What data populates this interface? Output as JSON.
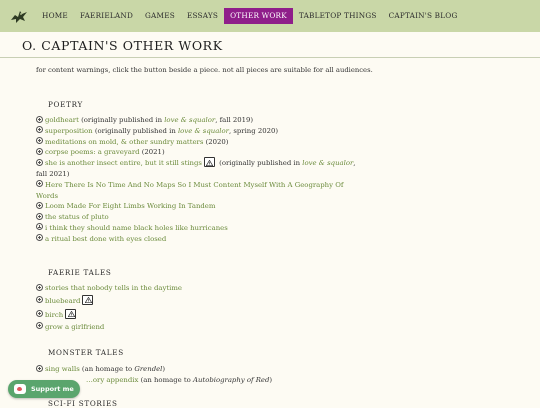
{
  "nav": {
    "items": [
      {
        "label": "Home"
      },
      {
        "label": "Faerieland"
      },
      {
        "label": "Games"
      },
      {
        "label": "Essays"
      },
      {
        "label": "Other Work"
      },
      {
        "label": "Tabletop Things"
      },
      {
        "label": "Captain's Blog"
      }
    ],
    "active": "Other Work"
  },
  "page": {
    "title": "O. CAPTAIN'S OTHER WORK",
    "intro": "for content warnings, click the button beside a piece. not all pieces are suitable for all audiences."
  },
  "poetry": {
    "heading": "Poetry",
    "items": [
      {
        "title": "goldheart",
        "pre": " (originally published in ",
        "pub": "love & squalor",
        "post": ", fall 2019)"
      },
      {
        "title": "superposition",
        "pre": " (originally published in ",
        "pub": "love & squalor",
        "post": ", spring 2020)"
      },
      {
        "title": "meditations on mold, & other sundry matters",
        "post": " (2020)"
      },
      {
        "title": "corpse poems: a graveyard",
        "post": " (2021)"
      },
      {
        "title": "she is another insect entire, but it still stings",
        "pre": " (originally published in ",
        "pub": "love & squalor",
        "post": ", fall 2021)"
      },
      {
        "title": "Here There Is No Time And No Maps So I Must Content Myself With A Geography Of Words"
      },
      {
        "title": "Loom Made For Eight Limbs Working In Tandem"
      },
      {
        "title": "the status of pluto"
      },
      {
        "title": "i think they should name black holes like hurricanes"
      },
      {
        "title": "a ritual best done with eyes closed"
      }
    ]
  },
  "faerie": {
    "heading": "Faerie Tales",
    "items": [
      {
        "title": "stories that nobody tells in the daytime"
      },
      {
        "title": "bluebeard"
      },
      {
        "title": "birch"
      },
      {
        "title": "grow a girlfriend"
      }
    ]
  },
  "monster": {
    "heading": "Monster Tales",
    "items": [
      {
        "title": "sing walls",
        "pre": " (an homage to ",
        "work": "Grendel",
        "post": ")"
      },
      {
        "title": "…ory appendix",
        "pre": " (an homage to ",
        "work": "Autobiography of Red",
        "post": ")"
      }
    ]
  },
  "scifi": {
    "heading": "Sci-Fi Stories"
  },
  "kofi": {
    "label": "Support me"
  }
}
